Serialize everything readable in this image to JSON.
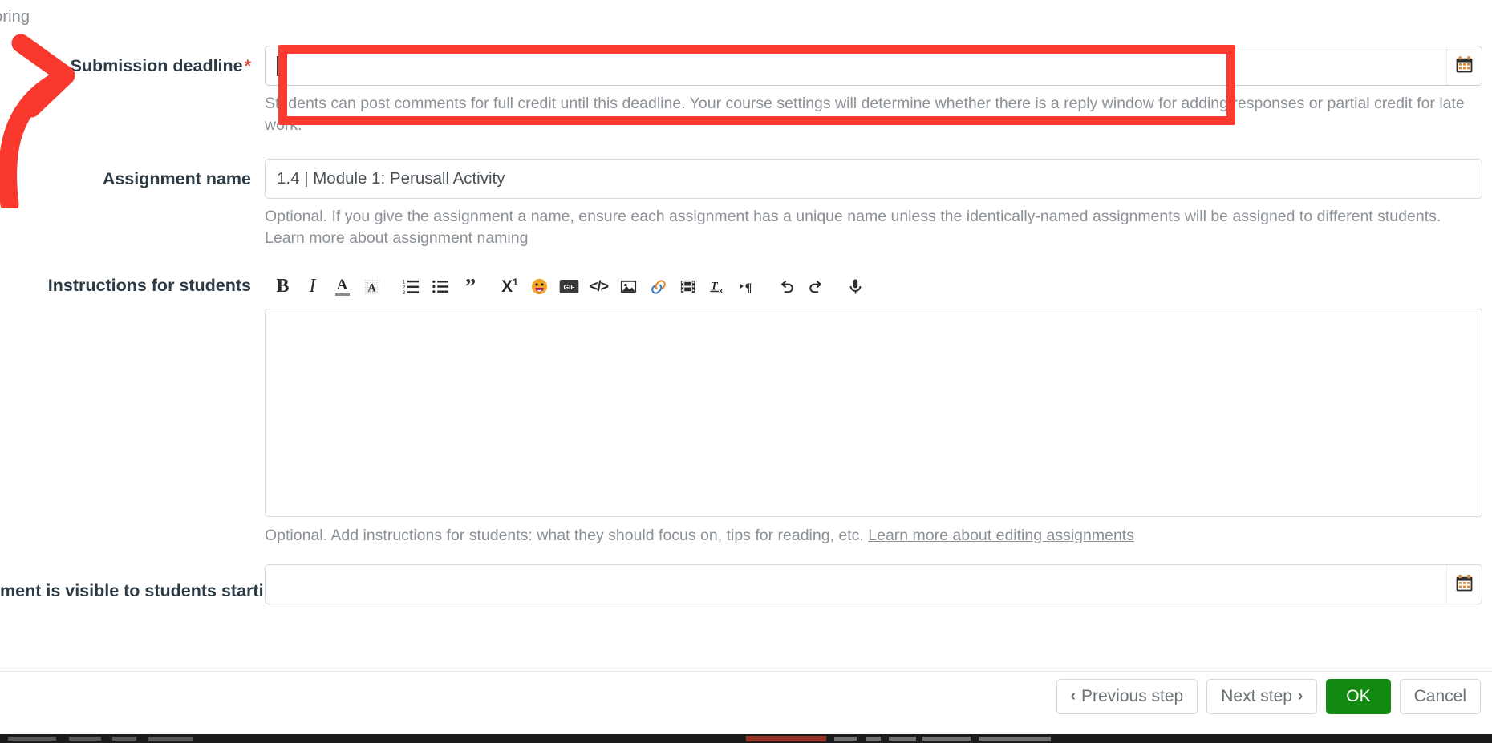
{
  "page": {
    "clipped_heading": "coring"
  },
  "fields": {
    "deadline": {
      "label": "Submission deadline",
      "required_marker": "*",
      "value": "",
      "placeholder": "",
      "help": "Students can post comments for full credit until this deadline. Your course settings will determine whether there is a reply window for adding responses or partial credit for late work.",
      "calendar_icon": "calendar-icon"
    },
    "assignment_name": {
      "label": "Assignment name",
      "value": "1.4 | Module 1: Perusall Activity",
      "placeholder": "",
      "help_text": "Optional. If you give the assignment a name, ensure each assignment has a unique name unless the identically-named assignments will be assigned to different students.",
      "help_link": "Learn more about assignment naming"
    },
    "instructions": {
      "label": "Instructions for students",
      "value": "",
      "help_text": "Optional. Add instructions for students: what they should focus on, tips for reading, etc.",
      "help_link": "Learn more about editing assignments"
    },
    "visible_on": {
      "label": "ment is visible to students starting on",
      "value": "",
      "placeholder": "",
      "calendar_icon": "calendar-icon"
    }
  },
  "toolbar": {
    "items": [
      {
        "name": "bold-icon",
        "glyph": "B",
        "style": "bold-serif"
      },
      {
        "name": "italic-icon",
        "glyph": "I",
        "style": "italic-serif"
      },
      {
        "name": "text-color-icon",
        "glyph": "A",
        "style": "underline-color"
      },
      {
        "name": "highlight-icon",
        "glyph": "A",
        "style": "highlight"
      },
      {
        "name": "ordered-list-icon",
        "glyph": "",
        "style": "ordered-list"
      },
      {
        "name": "bullet-list-icon",
        "glyph": "",
        "style": "bullet-list"
      },
      {
        "name": "blockquote-icon",
        "glyph": "”",
        "style": "quote"
      },
      {
        "name": "superscript-icon",
        "glyph": "X¹",
        "style": "sup"
      },
      {
        "name": "emoji-icon",
        "glyph": "😀",
        "style": "emoji"
      },
      {
        "name": "gif-icon",
        "glyph": "GIF",
        "style": "gif"
      },
      {
        "name": "code-icon",
        "glyph": "</>",
        "style": "code"
      },
      {
        "name": "image-icon",
        "glyph": "",
        "style": "image"
      },
      {
        "name": "link-icon",
        "glyph": "",
        "style": "link"
      },
      {
        "name": "video-icon",
        "glyph": "",
        "style": "video"
      },
      {
        "name": "clear-formatting-icon",
        "glyph": "",
        "style": "clearfmt"
      },
      {
        "name": "text-direction-icon",
        "glyph": "¶",
        "style": "rtl"
      },
      {
        "name": "undo-icon",
        "glyph": "↶",
        "style": "undo"
      },
      {
        "name": "redo-icon",
        "glyph": "↷",
        "style": "redo"
      },
      {
        "name": "microphone-icon",
        "glyph": "",
        "style": "mic"
      }
    ]
  },
  "footer": {
    "previous_label": "Previous step",
    "next_label": "Next step",
    "ok_label": "OK",
    "cancel_label": "Cancel",
    "prev_chevron": "‹",
    "next_chevron": "›"
  },
  "annotation": {
    "highlight_color": "#fb3b30",
    "arrow_color": "#f9392e",
    "arrow_target": "Submission deadline"
  },
  "colors": {
    "label": "#2d3b45",
    "help": "#8a9096",
    "border": "#d6d8da",
    "ok_green": "#128a12",
    "required_red": "#d64a3f"
  }
}
